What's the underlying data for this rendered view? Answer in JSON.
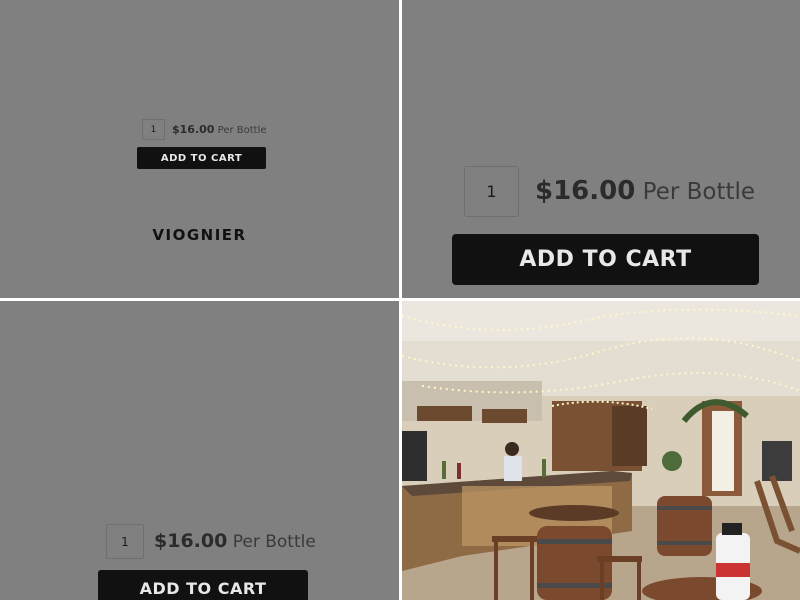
{
  "product": {
    "name": "VIOGNIER",
    "quantity": "1",
    "price": "$16.00",
    "price_unit": "Per Bottle",
    "add_to_cart_label": "ADD TO CART"
  },
  "colors": {
    "panel_bg": "#808080",
    "button_bg": "#111111",
    "button_text": "#e8e8e8"
  }
}
